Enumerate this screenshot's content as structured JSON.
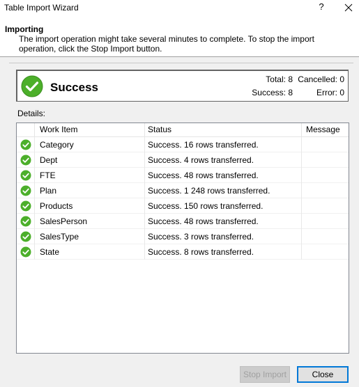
{
  "window": {
    "title": "Table Import Wizard",
    "help_label": "?",
    "close_label": "✕"
  },
  "header": {
    "title": "Importing",
    "description": "The import operation might take several minutes to complete. To stop the import operation, click the Stop Import button."
  },
  "status": {
    "text": "Success",
    "total": "Total: 8",
    "cancelled": "Cancelled: 0",
    "success": "Success: 8",
    "error": "Error: 0"
  },
  "details_label": "Details:",
  "grid": {
    "columns": [
      "Work Item",
      "Status",
      "Message"
    ],
    "rows": [
      {
        "item": "Category",
        "status": "Success. 16 rows transferred.",
        "message": ""
      },
      {
        "item": "Dept",
        "status": "Success. 4 rows transferred.",
        "message": ""
      },
      {
        "item": "FTE",
        "status": "Success. 48 rows transferred.",
        "message": ""
      },
      {
        "item": "Plan",
        "status": "Success. 1 248 rows transferred.",
        "message": ""
      },
      {
        "item": "Products",
        "status": "Success. 150 rows transferred.",
        "message": ""
      },
      {
        "item": "SalesPerson",
        "status": "Success. 48 rows transferred.",
        "message": ""
      },
      {
        "item": "SalesType",
        "status": "Success. 3 rows transferred.",
        "message": ""
      },
      {
        "item": "State",
        "status": "Success. 8 rows transferred.",
        "message": ""
      }
    ]
  },
  "buttons": {
    "stop_import": "Stop Import",
    "close": "Close"
  },
  "colors": {
    "success_green": "#4caf2a",
    "accent_blue": "#0078d7"
  }
}
